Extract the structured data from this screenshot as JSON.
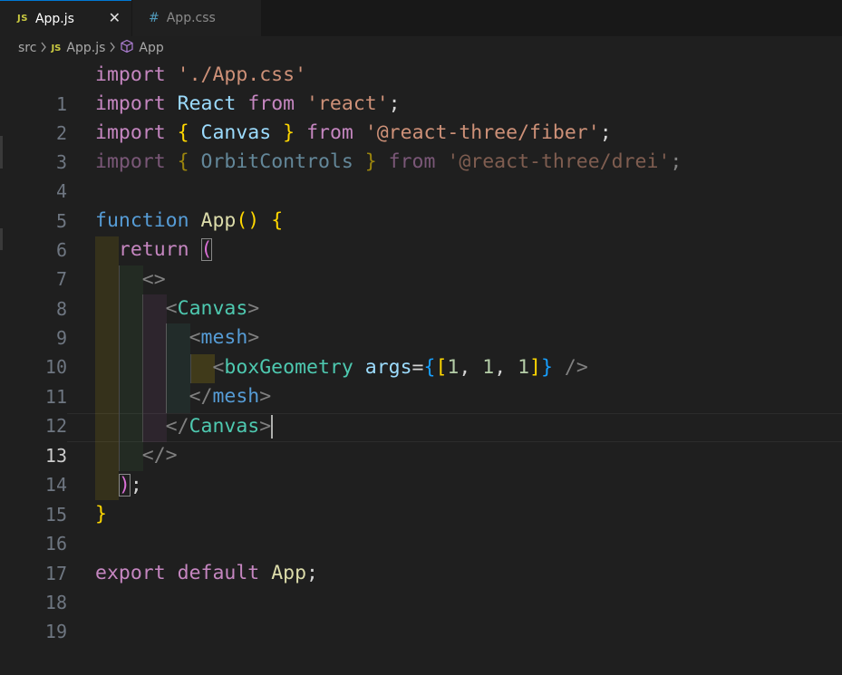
{
  "tabs": [
    {
      "badge": "JS",
      "label": "App.js",
      "active": true,
      "close": "✕"
    },
    {
      "badge": "#",
      "label": "App.css",
      "active": false
    }
  ],
  "breadcrumb": {
    "folder": "src",
    "file_badge": "JS",
    "file": "App.js",
    "symbol": "App"
  },
  "editor": {
    "current_line": 13,
    "line_numbers": [
      "1",
      "2",
      "3",
      "4",
      "5",
      "6",
      "7",
      "8",
      "9",
      "10",
      "11",
      "12",
      "13",
      "14",
      "15",
      "16",
      "17",
      "18",
      "19"
    ],
    "lines": {
      "l1": {
        "kw": "import",
        "str": "'./App.css'"
      },
      "l2": {
        "kw": "import",
        "name": "React",
        "from": "from",
        "str": "'react'",
        "semi": ";"
      },
      "l3": {
        "kw": "import",
        "open": "{",
        "name": "Canvas",
        "close": "}",
        "from": "from",
        "str": "'@react-three/fiber'",
        "semi": ";"
      },
      "l4": {
        "kw": "import",
        "open": "{",
        "name": "OrbitControls",
        "close": "}",
        "from": "from",
        "str": "'@react-three/drei'",
        "semi": ";"
      },
      "l6": {
        "kw": "function",
        "name": "App",
        "parens": "()",
        "brace": "{"
      },
      "l7": {
        "kw": "return",
        "paren": "("
      },
      "l8": {
        "tag": "<>"
      },
      "l9": {
        "lt": "<",
        "name": "Canvas",
        "gt": ">"
      },
      "l10": {
        "lt": "<",
        "name": "mesh",
        "gt": ">"
      },
      "l11": {
        "lt": "<",
        "name": "boxGeometry",
        "attr": "args",
        "eq": "=",
        "b1": "{",
        "b2": "[",
        "n1": "1",
        "c1": ", ",
        "n2": "1",
        "c2": ", ",
        "n3": "1",
        "b3": "]",
        "b4": "}",
        "end": " />"
      },
      "l12": {
        "lt": "</",
        "name": "mesh",
        "gt": ">"
      },
      "l13": {
        "lt": "</",
        "name": "Canvas",
        "gt": ">"
      },
      "l14": {
        "tag": "</>"
      },
      "l15": {
        "paren": ")",
        "semi": ";"
      },
      "l16": {
        "brace": "}"
      },
      "l18": {
        "kw1": "export",
        "kw2": "default",
        "name": "App",
        "semi": ";"
      }
    }
  },
  "colors": {
    "background": "#1f1f1f",
    "keyword": "#c586c0",
    "string": "#ce9178",
    "component": "#4ec9b0",
    "variable": "#9cdcfe",
    "function": "#dcdcaa",
    "accent": "#0078d4"
  },
  "icons": [
    "js-file-icon",
    "css-file-icon",
    "close-icon",
    "chevron-right-icon",
    "symbol-cube-icon"
  ]
}
